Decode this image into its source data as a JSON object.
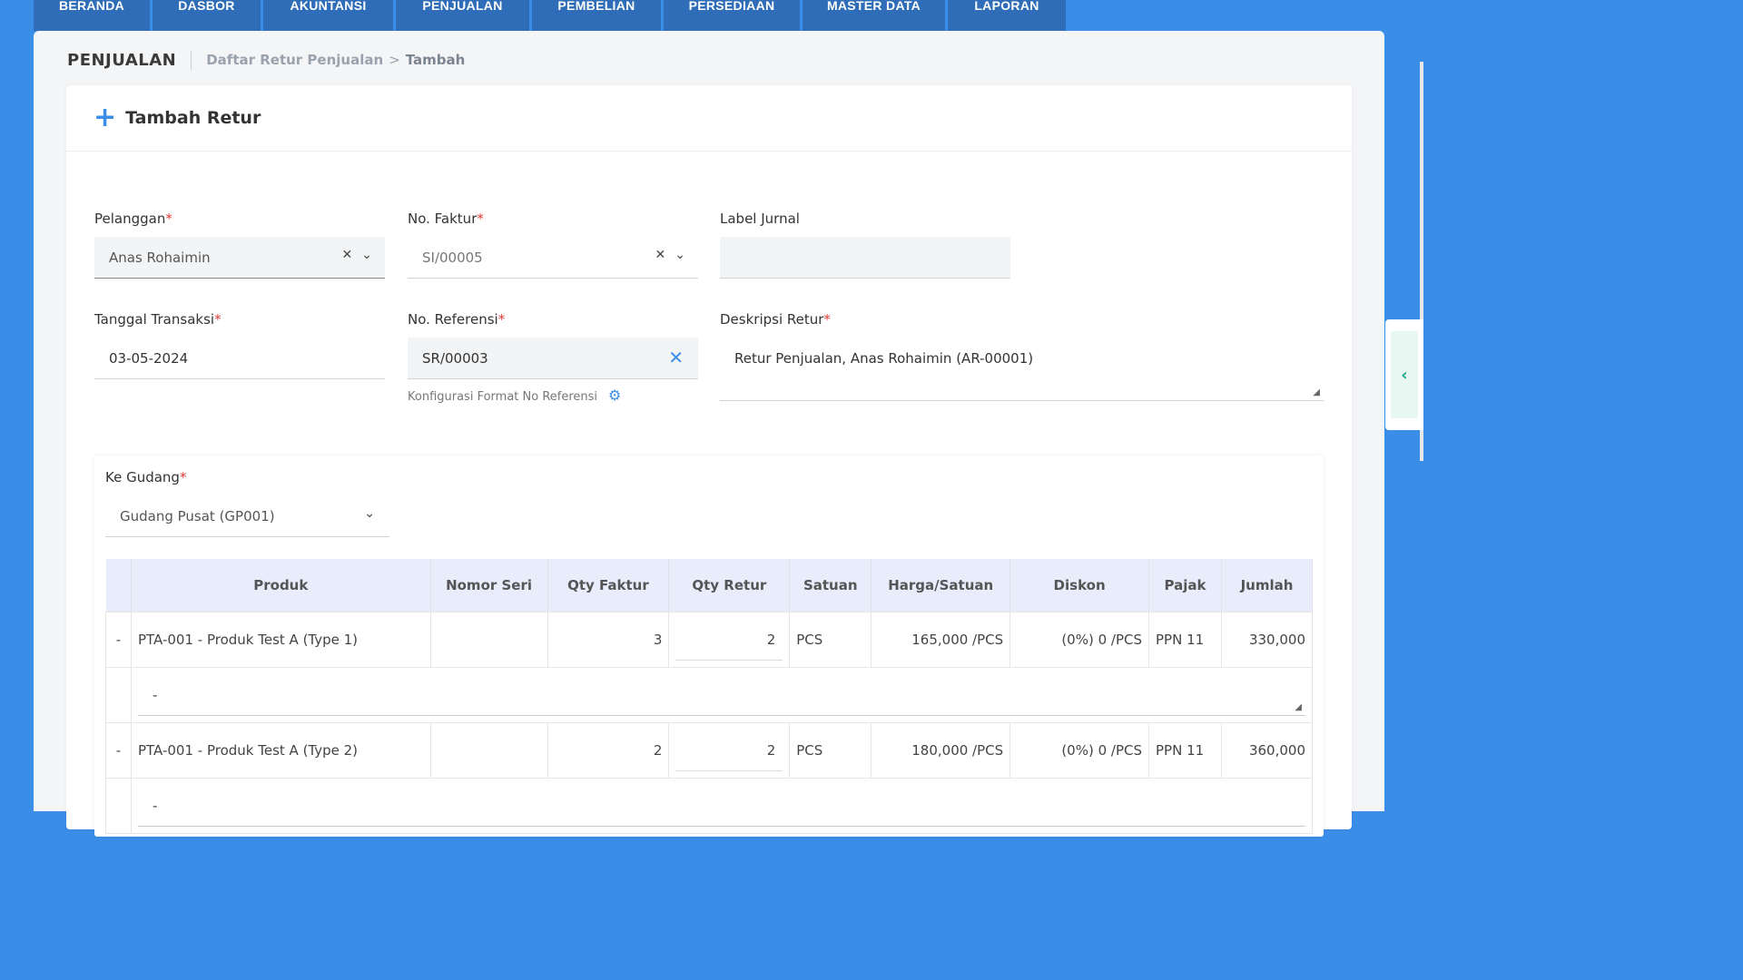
{
  "nav": {
    "tabs": [
      "BERANDA",
      "DASBOR",
      "AKUNTANSI",
      "PENJUALAN",
      "PEMBELIAN",
      "PERSEDIAAN",
      "MASTER DATA",
      "LAPORAN"
    ]
  },
  "breadcrumb": {
    "section": "PENJUALAN",
    "parent": "Daftar Retur Penjualan",
    "separator": ">",
    "current": "Tambah"
  },
  "card": {
    "title": "Tambah Retur"
  },
  "form": {
    "pelanggan": {
      "label": "Pelanggan",
      "required": "*",
      "value": "Anas Rohaimin"
    },
    "no_faktur": {
      "label": "No. Faktur",
      "required": "*",
      "value": "SI/00005"
    },
    "label_jurnal": {
      "label": "Label Jurnal",
      "value": ""
    },
    "tanggal": {
      "label": "Tanggal Transaksi",
      "required": "*",
      "value": "03-05-2024"
    },
    "no_referensi": {
      "label": "No. Referensi",
      "required": "*",
      "value": "SR/00003",
      "hint": "Konfigurasi Format No Referensi"
    },
    "deskripsi": {
      "label": "Deskripsi Retur",
      "required": "*",
      "value": "Retur Penjualan, Anas Rohaimin (AR-00001)"
    },
    "gudang": {
      "label": "Ke Gudang",
      "required": "*",
      "value": "Gudang Pusat (GP001)"
    }
  },
  "table": {
    "headers": [
      "",
      "Produk",
      "Nomor Seri",
      "Qty Faktur",
      "Qty Retur",
      "Satuan",
      "Harga/Satuan",
      "Diskon",
      "Pajak",
      "Jumlah"
    ],
    "rows": [
      {
        "mark": "-",
        "produk": "PTA-001 - Produk Test A (Type 1)",
        "nomor_seri": "",
        "qty_faktur": "3",
        "qty_retur": "2",
        "satuan": "PCS",
        "harga": "165,000 /PCS",
        "diskon": "(0%) 0 /PCS",
        "pajak": "PPN 11",
        "jumlah": "330,000",
        "note": "-"
      },
      {
        "mark": "-",
        "produk": "PTA-001 - Produk Test A (Type 2)",
        "nomor_seri": "",
        "qty_faktur": "2",
        "qty_retur": "2",
        "satuan": "PCS",
        "harga": "180,000 /PCS",
        "diskon": "(0%) 0 /PCS",
        "pajak": "PPN 11",
        "jumlah": "360,000",
        "note": "-"
      }
    ]
  },
  "colors": {
    "accent": "#3b8ee8",
    "nav_tab": "#2f6db8",
    "required": "#e53935"
  }
}
